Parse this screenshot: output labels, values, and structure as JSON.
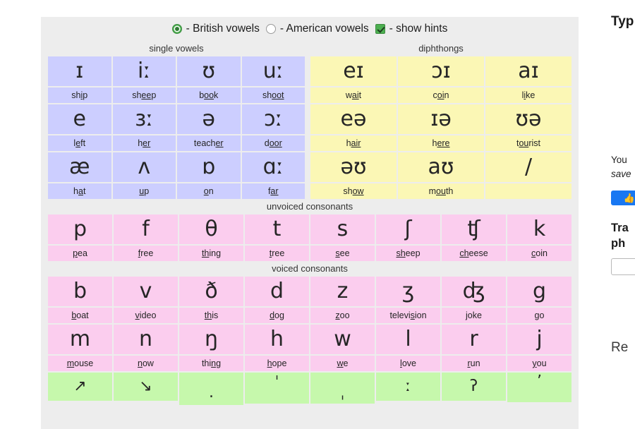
{
  "options": {
    "british": {
      "label": "- British vowels",
      "state": "selected",
      "icon": "radio-on-icon"
    },
    "american": {
      "label": "- American vowels",
      "state": "unselected",
      "icon": "radio-off-icon"
    },
    "hints": {
      "label": "- show hints",
      "state": "checked",
      "icon": "checkbox-checked-icon"
    },
    "accent_color": "#4caf50"
  },
  "sections": {
    "single_vowels": "single vowels",
    "diphthongs": "diphthongs",
    "unvoiced_consonants": "unvoiced consonants",
    "voiced_consonants": "voiced consonants"
  },
  "colors": {
    "vowel_bg": "#ccceff",
    "diphthong_bg": "#fbf7b5",
    "consonant_bg": "#fbcdee",
    "prosody_bg": "#c6f8ac",
    "panel_bg": "#ededed"
  },
  "vowels": [
    [
      {
        "symbol": "ɪ",
        "hint_before": "sh",
        "hint_mark": "i",
        "hint_after": "p"
      },
      {
        "symbol": "iː",
        "hint_before": "sh",
        "hint_mark": "ee",
        "hint_after": "p"
      },
      {
        "symbol": "ʊ",
        "hint_before": "b",
        "hint_mark": "oo",
        "hint_after": "k"
      },
      {
        "symbol": "uː",
        "hint_before": "sh",
        "hint_mark": "oot",
        "hint_after": ""
      }
    ],
    [
      {
        "symbol": "e",
        "hint_before": "l",
        "hint_mark": "e",
        "hint_after": "ft"
      },
      {
        "symbol": "ɜː",
        "hint_before": "h",
        "hint_mark": "er",
        "hint_after": ""
      },
      {
        "symbol": "ə",
        "hint_before": "teach",
        "hint_mark": "er",
        "hint_after": ""
      },
      {
        "symbol": "ɔː",
        "hint_before": "d",
        "hint_mark": "oor",
        "hint_after": ""
      }
    ],
    [
      {
        "symbol": "æ",
        "hint_before": "h",
        "hint_mark": "a",
        "hint_after": "t"
      },
      {
        "symbol": "ʌ",
        "hint_before": "",
        "hint_mark": "u",
        "hint_after": "p"
      },
      {
        "symbol": "ɒ",
        "hint_before": "",
        "hint_mark": "o",
        "hint_after": "n"
      },
      {
        "symbol": "ɑː",
        "hint_before": "f",
        "hint_mark": "ar",
        "hint_after": ""
      }
    ]
  ],
  "diphthongs": [
    [
      {
        "symbol": "eɪ",
        "hint_before": "w",
        "hint_mark": "ai",
        "hint_after": "t"
      },
      {
        "symbol": "ɔɪ",
        "hint_before": "c",
        "hint_mark": "oi",
        "hint_after": "n"
      },
      {
        "symbol": "aɪ",
        "hint_before": "l",
        "hint_mark": "i",
        "hint_after": "ke"
      }
    ],
    [
      {
        "symbol": "eə",
        "hint_before": "h",
        "hint_mark": "air",
        "hint_after": ""
      },
      {
        "symbol": "ɪə",
        "hint_before": "h",
        "hint_mark": "ere",
        "hint_after": ""
      },
      {
        "symbol": "ʊə",
        "hint_before": "t",
        "hint_mark": "ou",
        "hint_after": "rist"
      }
    ],
    [
      {
        "symbol": "əʊ",
        "hint_before": "sh",
        "hint_mark": "ow",
        "hint_after": ""
      },
      {
        "symbol": "aʊ",
        "hint_before": "m",
        "hint_mark": "ou",
        "hint_after": "th"
      },
      {
        "symbol": "/",
        "hint_before": "",
        "hint_mark": "",
        "hint_after": ""
      }
    ]
  ],
  "unvoiced_consonants": [
    [
      {
        "symbol": "p",
        "hint_before": "",
        "hint_mark": "p",
        "hint_after": "ea"
      },
      {
        "symbol": "f",
        "hint_before": "",
        "hint_mark": "f",
        "hint_after": "ree"
      },
      {
        "symbol": "θ",
        "hint_before": "",
        "hint_mark": "th",
        "hint_after": "ing"
      },
      {
        "symbol": "t",
        "hint_before": "",
        "hint_mark": "t",
        "hint_after": "ree"
      },
      {
        "symbol": "s",
        "hint_before": "",
        "hint_mark": "s",
        "hint_after": "ee"
      },
      {
        "symbol": "ʃ",
        "hint_before": "",
        "hint_mark": "sh",
        "hint_after": "eep"
      },
      {
        "symbol": "ʧ",
        "hint_before": "",
        "hint_mark": "ch",
        "hint_after": "eese"
      },
      {
        "symbol": "k",
        "hint_before": "",
        "hint_mark": "c",
        "hint_after": "oin"
      }
    ]
  ],
  "voiced_consonants": [
    [
      {
        "symbol": "b",
        "hint_before": "",
        "hint_mark": "b",
        "hint_after": "oat"
      },
      {
        "symbol": "v",
        "hint_before": "",
        "hint_mark": "v",
        "hint_after": "ideo"
      },
      {
        "symbol": "ð",
        "hint_before": "",
        "hint_mark": "th",
        "hint_after": "is"
      },
      {
        "symbol": "d",
        "hint_before": "",
        "hint_mark": "d",
        "hint_after": "og"
      },
      {
        "symbol": "z",
        "hint_before": "",
        "hint_mark": "z",
        "hint_after": "oo"
      },
      {
        "symbol": "ʒ",
        "hint_before": "televi",
        "hint_mark": "s",
        "hint_after": "ion"
      },
      {
        "symbol": "ʤ",
        "hint_before": "joke",
        "hint_mark": "",
        "hint_after": ""
      },
      {
        "symbol": "g",
        "hint_before": "go",
        "hint_mark": "",
        "hint_after": ""
      }
    ],
    [
      {
        "symbol": "m",
        "hint_before": "",
        "hint_mark": "m",
        "hint_after": "ouse"
      },
      {
        "symbol": "n",
        "hint_before": "",
        "hint_mark": "n",
        "hint_after": "ow"
      },
      {
        "symbol": "ŋ",
        "hint_before": "thi",
        "hint_mark": "ng",
        "hint_after": ""
      },
      {
        "symbol": "h",
        "hint_before": "",
        "hint_mark": "h",
        "hint_after": "ope"
      },
      {
        "symbol": "w",
        "hint_before": "",
        "hint_mark": "w",
        "hint_after": "e"
      },
      {
        "symbol": "l",
        "hint_before": "",
        "hint_mark": "l",
        "hint_after": "ove"
      },
      {
        "symbol": "r",
        "hint_before": "",
        "hint_mark": "r",
        "hint_after": "un"
      },
      {
        "symbol": "j",
        "hint_before": "",
        "hint_mark": "y",
        "hint_after": "ou"
      }
    ]
  ],
  "prosody": [
    {
      "symbol": "↗",
      "name": "rising-intonation"
    },
    {
      "symbol": "↘",
      "name": "falling-intonation"
    },
    {
      "symbol": ".",
      "name": "syllable-break"
    },
    {
      "symbol": "ˈ",
      "name": "primary-stress"
    },
    {
      "symbol": "ˌ",
      "name": "secondary-stress"
    },
    {
      "symbol": "ː",
      "name": "length-mark"
    },
    {
      "symbol": "ʔ",
      "name": "glottal-stop"
    },
    {
      "symbol": "ʼ",
      "name": "ejective-mark"
    }
  ],
  "right_panel": {
    "title": "Typ",
    "paragraph_line1": "You",
    "paragraph_line2": "save",
    "like_button": "",
    "subtitle_line1": "Tra",
    "subtitle_line2": "ph",
    "input_value": "",
    "result_title": "Re"
  }
}
